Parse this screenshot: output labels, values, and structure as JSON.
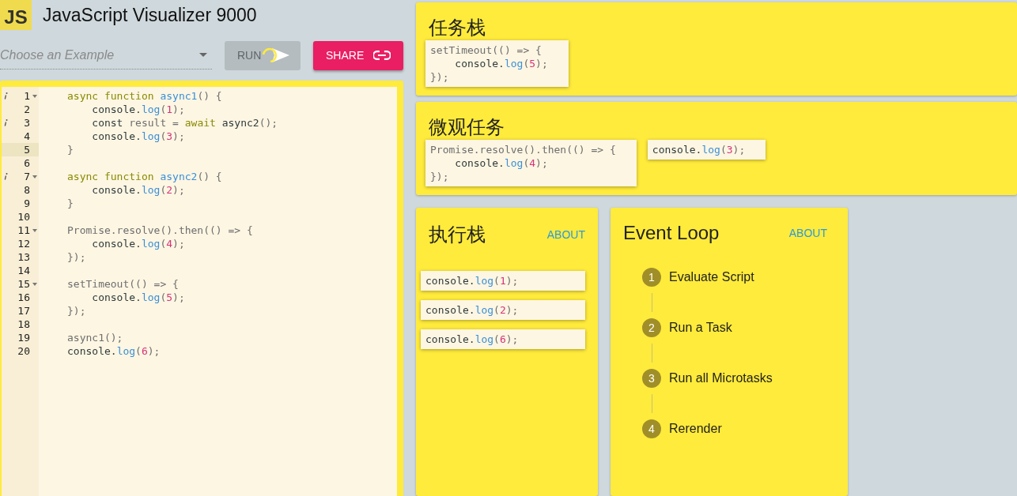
{
  "app": {
    "logo": "JS",
    "title": "JavaScript Visualizer 9000"
  },
  "controls": {
    "example_select": {
      "placeholder": "Choose an Example"
    },
    "run_button": {
      "label": "RUN",
      "disabled": true,
      "loading": true
    },
    "share_button": {
      "label": "SHARE"
    }
  },
  "editor": {
    "lines": [
      {
        "number": "1",
        "info": true,
        "fold": true,
        "active": false,
        "tokens": [
          {
            "kind": "kw",
            "t": "async function "
          },
          {
            "kind": "name",
            "t": "async1"
          },
          {
            "kind": "punct",
            "t": "() {"
          }
        ]
      },
      {
        "number": "2",
        "info": false,
        "fold": false,
        "active": false,
        "tokens": [
          {
            "kind": "text",
            "t": "    console."
          },
          {
            "kind": "name",
            "t": "log"
          },
          {
            "kind": "punct",
            "t": "("
          },
          {
            "kind": "num",
            "t": "1"
          },
          {
            "kind": "punct",
            "t": ");"
          }
        ]
      },
      {
        "number": "3",
        "info": true,
        "fold": false,
        "active": false,
        "tokens": [
          {
            "kind": "text",
            "t": "    const "
          },
          {
            "kind": "punct",
            "t": "result = "
          },
          {
            "kind": "kw",
            "t": "await "
          },
          {
            "kind": "text",
            "t": "async2"
          },
          {
            "kind": "punct",
            "t": "();"
          }
        ]
      },
      {
        "number": "4",
        "info": false,
        "fold": false,
        "active": false,
        "tokens": [
          {
            "kind": "text",
            "t": "    console."
          },
          {
            "kind": "name",
            "t": "log"
          },
          {
            "kind": "punct",
            "t": "("
          },
          {
            "kind": "num",
            "t": "3"
          },
          {
            "kind": "punct",
            "t": ");"
          }
        ]
      },
      {
        "number": "5",
        "info": false,
        "fold": false,
        "active": true,
        "tokens": [
          {
            "kind": "punct",
            "t": "}"
          }
        ]
      },
      {
        "number": "6",
        "info": false,
        "fold": false,
        "active": false
      },
      {
        "number": "7",
        "info": true,
        "fold": true,
        "active": false,
        "tokens": [
          {
            "kind": "kw",
            "t": "async function "
          },
          {
            "kind": "name",
            "t": "async2"
          },
          {
            "kind": "punct",
            "t": "() {"
          }
        ]
      },
      {
        "number": "8",
        "info": false,
        "fold": false,
        "active": false,
        "tokens": [
          {
            "kind": "text",
            "t": "    console."
          },
          {
            "kind": "name",
            "t": "log"
          },
          {
            "kind": "punct",
            "t": "("
          },
          {
            "kind": "num",
            "t": "2"
          },
          {
            "kind": "punct",
            "t": ");"
          }
        ]
      },
      {
        "number": "9",
        "info": false,
        "fold": false,
        "active": false,
        "tokens": [
          {
            "kind": "punct",
            "t": "}"
          }
        ]
      },
      {
        "number": "10",
        "info": false,
        "fold": false,
        "active": false
      },
      {
        "number": "11",
        "info": false,
        "fold": true,
        "active": false,
        "tokens": [
          {
            "kind": "punct",
            "t": "Promise.resolve().then(() => {"
          }
        ]
      },
      {
        "number": "12",
        "info": false,
        "fold": false,
        "active": false,
        "tokens": [
          {
            "kind": "text",
            "t": "    console."
          },
          {
            "kind": "name",
            "t": "log"
          },
          {
            "kind": "punct",
            "t": "("
          },
          {
            "kind": "num",
            "t": "4"
          },
          {
            "kind": "punct",
            "t": ");"
          }
        ]
      },
      {
        "number": "13",
        "info": false,
        "fold": false,
        "active": false,
        "tokens": [
          {
            "kind": "punct",
            "t": "});"
          }
        ]
      },
      {
        "number": "14",
        "info": false,
        "fold": false,
        "active": false
      },
      {
        "number": "15",
        "info": false,
        "fold": true,
        "active": false,
        "tokens": [
          {
            "kind": "punct",
            "t": "setTimeout(() => {"
          }
        ]
      },
      {
        "number": "16",
        "info": false,
        "fold": false,
        "active": false,
        "tokens": [
          {
            "kind": "text",
            "t": "    console."
          },
          {
            "kind": "name",
            "t": "log"
          },
          {
            "kind": "punct",
            "t": "("
          },
          {
            "kind": "num",
            "t": "5"
          },
          {
            "kind": "punct",
            "t": ");"
          }
        ]
      },
      {
        "number": "17",
        "info": false,
        "fold": false,
        "active": false,
        "tokens": [
          {
            "kind": "punct",
            "t": "});"
          }
        ]
      },
      {
        "number": "18",
        "info": false,
        "fold": false,
        "active": false
      },
      {
        "number": "19",
        "info": false,
        "fold": false,
        "active": false,
        "tokens": [
          {
            "kind": "punct",
            "t": "async1();"
          }
        ]
      },
      {
        "number": "20",
        "info": false,
        "fold": false,
        "active": false,
        "tokens": [
          {
            "kind": "text",
            "t": "console."
          },
          {
            "kind": "name",
            "t": "log"
          },
          {
            "kind": "punct",
            "t": "("
          },
          {
            "kind": "num",
            "t": "6"
          },
          {
            "kind": "punct",
            "t": ");"
          }
        ]
      }
    ]
  },
  "task_queue": {
    "title": "任务栈",
    "items": [
      {
        "lines": [
          [
            {
              "kind": "punct",
              "t": "setTimeout(() => {"
            }
          ],
          [
            {
              "kind": "text",
              "t": "    console."
            },
            {
              "kind": "name",
              "t": "log"
            },
            {
              "kind": "punct",
              "t": "("
            },
            {
              "kind": "num",
              "t": "5"
            },
            {
              "kind": "punct",
              "t": ");"
            }
          ],
          [
            {
              "kind": "punct",
              "t": "});"
            }
          ]
        ]
      }
    ]
  },
  "microtask_queue": {
    "title": "微观任务",
    "items": [
      {
        "lines": [
          [
            {
              "kind": "punct",
              "t": "Promise.resolve().then(() => {"
            }
          ],
          [
            {
              "kind": "text",
              "t": "    console."
            },
            {
              "kind": "name",
              "t": "log"
            },
            {
              "kind": "punct",
              "t": "("
            },
            {
              "kind": "num",
              "t": "4"
            },
            {
              "kind": "punct",
              "t": ");"
            }
          ],
          [
            {
              "kind": "punct",
              "t": "});"
            }
          ]
        ]
      },
      {
        "lines": [
          [
            {
              "kind": "text",
              "t": "console."
            },
            {
              "kind": "name",
              "t": "log"
            },
            {
              "kind": "punct",
              "t": "("
            },
            {
              "kind": "num",
              "t": "3"
            },
            {
              "kind": "punct",
              "t": ");"
            }
          ]
        ]
      }
    ]
  },
  "call_stack": {
    "title": "执行栈",
    "about": "ABOUT",
    "items": [
      {
        "lines": [
          [
            {
              "kind": "text",
              "t": "console."
            },
            {
              "kind": "name",
              "t": "log"
            },
            {
              "kind": "punct",
              "t": "("
            },
            {
              "kind": "num",
              "t": "1"
            },
            {
              "kind": "punct",
              "t": ");"
            }
          ]
        ]
      },
      {
        "lines": [
          [
            {
              "kind": "text",
              "t": "console."
            },
            {
              "kind": "name",
              "t": "log"
            },
            {
              "kind": "punct",
              "t": "("
            },
            {
              "kind": "num",
              "t": "2"
            },
            {
              "kind": "punct",
              "t": ");"
            }
          ]
        ]
      },
      {
        "lines": [
          [
            {
              "kind": "text",
              "t": "console."
            },
            {
              "kind": "name",
              "t": "log"
            },
            {
              "kind": "punct",
              "t": "("
            },
            {
              "kind": "num",
              "t": "6"
            },
            {
              "kind": "punct",
              "t": ");"
            }
          ]
        ]
      }
    ]
  },
  "event_loop": {
    "title": "Event Loop",
    "about": "ABOUT",
    "steps": [
      {
        "number": "1",
        "label": "Evaluate Script"
      },
      {
        "number": "2",
        "label": "Run a Task"
      },
      {
        "number": "3",
        "label": "Run all Microtasks"
      },
      {
        "number": "4",
        "label": "Rerender"
      }
    ]
  }
}
